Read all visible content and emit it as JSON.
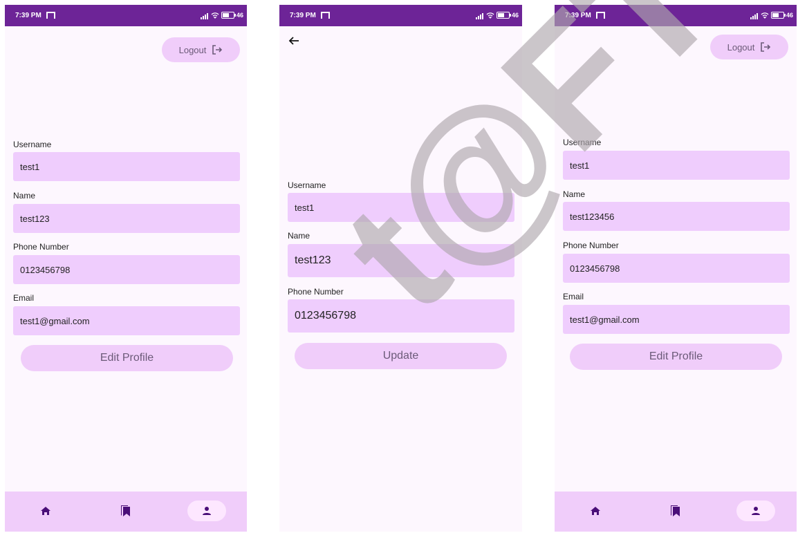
{
  "status_bar": {
    "time": "7:39 PM",
    "battery": "46"
  },
  "screen1": {
    "logout_label": "Logout",
    "fields": [
      {
        "label": "Username",
        "value": "test1"
      },
      {
        "label": "Name",
        "value": "test123"
      },
      {
        "label": "Phone Number",
        "value": "0123456798"
      },
      {
        "label": "Email",
        "value": "test1@gmail.com"
      }
    ],
    "button_label": "Edit Profile"
  },
  "screen2": {
    "fields": [
      {
        "label": "Username",
        "value": "test1"
      },
      {
        "label": "Name",
        "value": "test123"
      },
      {
        "label": "Phone Number",
        "value": "0123456798"
      }
    ],
    "button_label": "Update"
  },
  "screen3": {
    "logout_label": "Logout",
    "fields": [
      {
        "label": "Username",
        "value": "test1"
      },
      {
        "label": "Name",
        "value": "test123456"
      },
      {
        "label": "Phone Number",
        "value": "0123456798"
      },
      {
        "label": "Email",
        "value": "test1@gmail.com"
      }
    ],
    "button_label": "Edit Profile"
  },
  "watermark": "t@FTSM",
  "icons": {
    "home": "home-icon",
    "bookmarks": "bookmarks-icon",
    "profile": "person-icon",
    "logout": "logout-icon",
    "back": "arrow-back-icon"
  },
  "colors": {
    "status_bar": "#6d2497",
    "field_bg": "#efcdfd",
    "button_bg": "#f0cdfa",
    "nav_icon": "#4a0e78"
  }
}
